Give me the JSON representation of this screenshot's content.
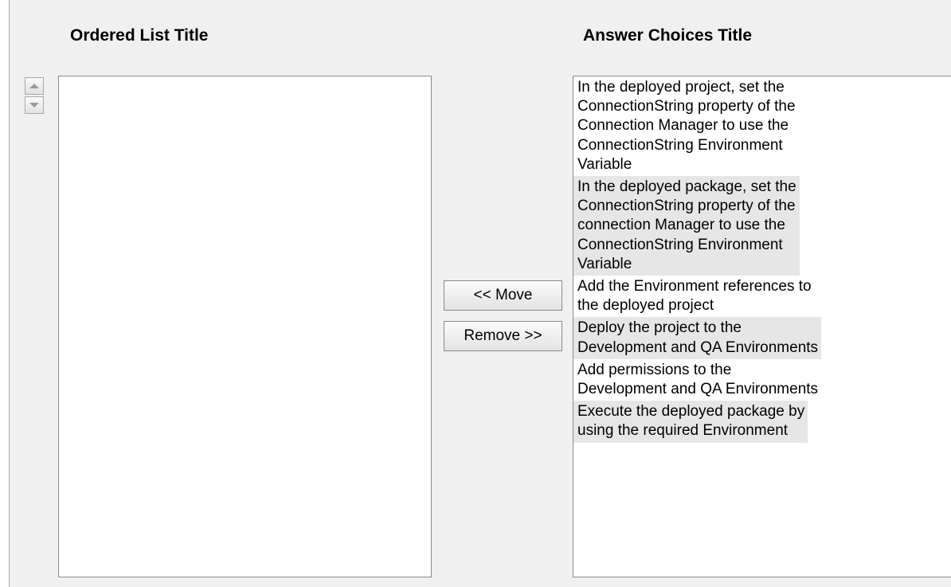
{
  "ordered_list": {
    "title": "Ordered List Title",
    "items": []
  },
  "answer_choices": {
    "title": "Answer Choices Title",
    "items": [
      "In the deployed project, set the\nConnectionString property of the\nConnection Manager to use the\nConnectionString Environment\nVariable",
      "In the deployed package, set the\nConnectionString property of the\nconnection Manager to use the\nConnectionString Environment\nVariable",
      "Add the Environment references to\nthe deployed project",
      "Deploy the project to the\nDevelopment and QA Environments",
      "Add permissions to the\nDevelopment and QA Environments",
      "Execute the deployed package by\nusing the required Environment"
    ]
  },
  "buttons": {
    "move_label": "<< Move",
    "remove_label": "Remove >>"
  },
  "icons": {
    "move_up": "triangle-up-icon",
    "move_down": "triangle-down-icon"
  },
  "colors": {
    "panel_bg": "#f0f0f0",
    "list_bg": "#ffffff",
    "alt_row_bg": "#e6e6e6",
    "border": "#8a8a8a"
  }
}
